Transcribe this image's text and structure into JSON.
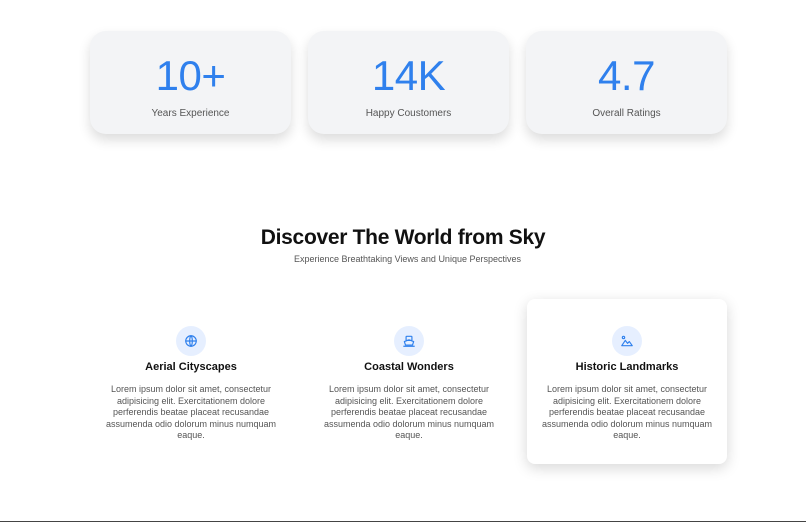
{
  "stats": [
    {
      "value": "10+",
      "label": "Years Experience"
    },
    {
      "value": "14K",
      "label": "Happy Coustomers"
    },
    {
      "value": "4.7",
      "label": "Overall Ratings"
    }
  ],
  "section": {
    "title": "Discover The World from Sky",
    "subtitle": "Experience Breathtaking Views and Unique Perspectives"
  },
  "features": [
    {
      "icon": "globe-icon",
      "title": "Aerial Cityscapes",
      "description": "Lorem ipsum dolor sit amet, consectetur adipisicing elit. Exercitationem dolore perferendis beatae placeat recusandae assumenda odio dolorum minus numquam eaque."
    },
    {
      "icon": "ship-icon",
      "title": "Coastal Wonders",
      "description": "Lorem ipsum dolor sit amet, consectetur adipisicing elit. Exercitationem dolore perferendis beatae placeat recusandae assumenda odio dolorum minus numquam eaque."
    },
    {
      "icon": "landmark-icon",
      "title": "Historic Landmarks",
      "description": "Lorem ipsum dolor sit amet, consectetur adipisicing elit. Exercitationem dolore perferendis beatae placeat recusandae assumenda odio dolorum minus numquam eaque."
    }
  ],
  "colors": {
    "accent": "#2f80ed",
    "card_bg": "#f3f4f6",
    "icon_bg": "#e6efff"
  }
}
